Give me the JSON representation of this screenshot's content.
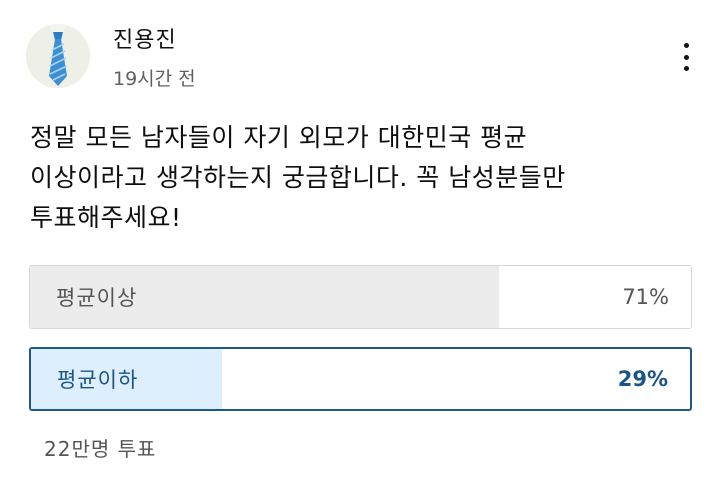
{
  "post": {
    "author": "진용진",
    "time": "19시간 전",
    "avatar_icon": "necktie-icon",
    "menu_icon": "more-vert-icon",
    "text_lines": [
      "정말 모든 남자들이 자기 외모가 대한민국 평균",
      "이상이라고 생각하는지 궁금합니다. 꼭 남성분들만",
      "투표해주세요!"
    ]
  },
  "poll": {
    "options": [
      {
        "label": "평균이상",
        "percent_text": "71%",
        "percent": 71,
        "selected": false
      },
      {
        "label": "평균이하",
        "percent_text": "29%",
        "percent": 29,
        "selected": true
      }
    ],
    "vote_count": "22만명 투표"
  },
  "colors": {
    "selected_border": "#1c5a8c",
    "selected_text": "#1b5588",
    "selected_fill": "#ddeefc",
    "unselected_fill": "#ececec",
    "unselected_border": "#d6d6d6",
    "avatar_bg": "#eef0e8",
    "tie_blue": "#3d8fd4"
  }
}
